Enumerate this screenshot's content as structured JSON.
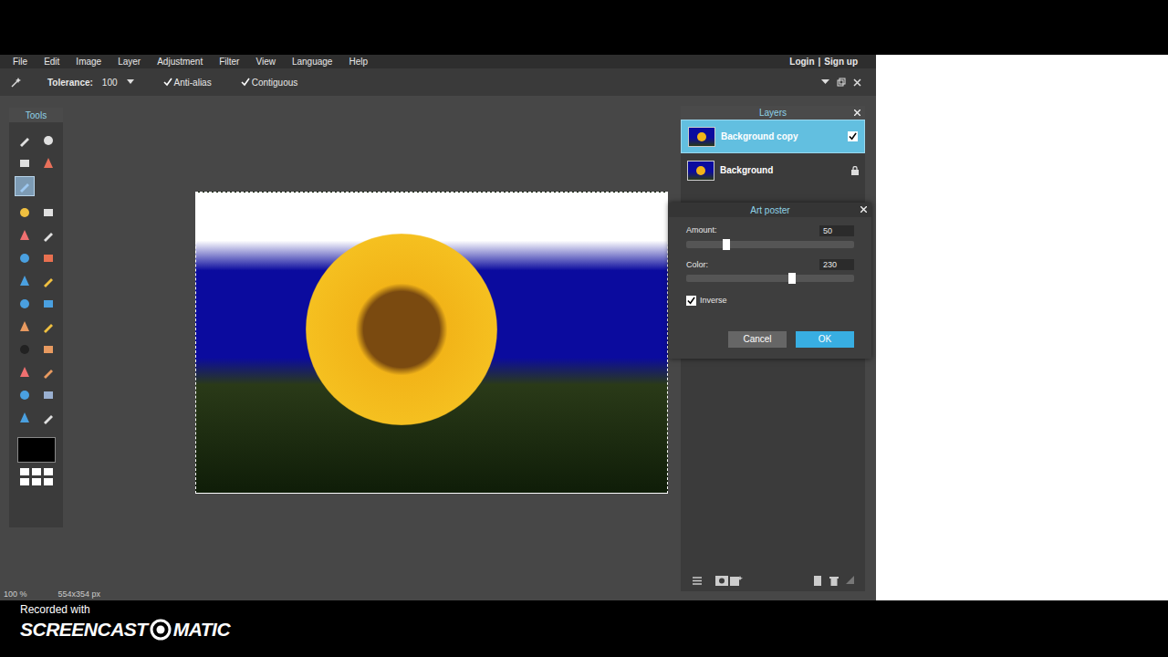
{
  "menu": [
    "File",
    "Edit",
    "Image",
    "Layer",
    "Adjustment",
    "Filter",
    "View",
    "Language",
    "Help"
  ],
  "account": {
    "login": "Login",
    "separator": "|",
    "signup": "Sign up"
  },
  "options": {
    "tolerance_label": "Tolerance:",
    "tolerance": "100",
    "checks": [
      {
        "label": "Anti-alias",
        "checked": true
      },
      {
        "label": "Contiguous",
        "checked": true
      }
    ]
  },
  "tools": {
    "title": "Tools",
    "groups": [
      [
        {
          "selected": false
        },
        {
          "selected": false
        },
        {
          "selected": false
        },
        {
          "selected": false
        },
        {
          "selected": true
        }
      ],
      [
        {
          "selected": false
        },
        {
          "selected": false
        },
        {
          "selected": false
        },
        {
          "selected": false
        },
        {
          "selected": false
        },
        {
          "selected": false
        },
        {
          "selected": false
        },
        {
          "selected": false
        },
        {
          "selected": false
        },
        {
          "selected": false
        },
        {
          "selected": false
        },
        {
          "selected": false
        },
        {
          "selected": false
        },
        {
          "selected": false
        },
        {
          "selected": false
        },
        {
          "selected": false
        },
        {
          "selected": false
        },
        {
          "selected": false
        },
        {
          "selected": false
        },
        {
          "selected": false
        }
      ]
    ]
  },
  "layers": {
    "title": "Layers",
    "items": [
      {
        "name": "Background copy",
        "selected": true,
        "checked": true,
        "locked": false
      },
      {
        "name": "Background",
        "selected": false,
        "checked": false,
        "locked": true
      }
    ]
  },
  "dialog": {
    "title": "Art poster",
    "sliders": [
      {
        "label": "Amount:",
        "value": "50",
        "level": 0.24
      },
      {
        "label": "Color:",
        "value": "230",
        "level": 0.63
      }
    ],
    "inverse": {
      "label": "Inverse",
      "checked": true
    },
    "buttons": [
      {
        "label": "Cancel",
        "primary": false
      },
      {
        "label": "OK",
        "primary": true
      }
    ]
  },
  "status": {
    "zoom": "100",
    "unit": "%",
    "size": "554x354 px"
  },
  "recorder": {
    "caption": "Recorded with",
    "brand_left": "SCREENCAST",
    "brand_right": "MATIC"
  }
}
